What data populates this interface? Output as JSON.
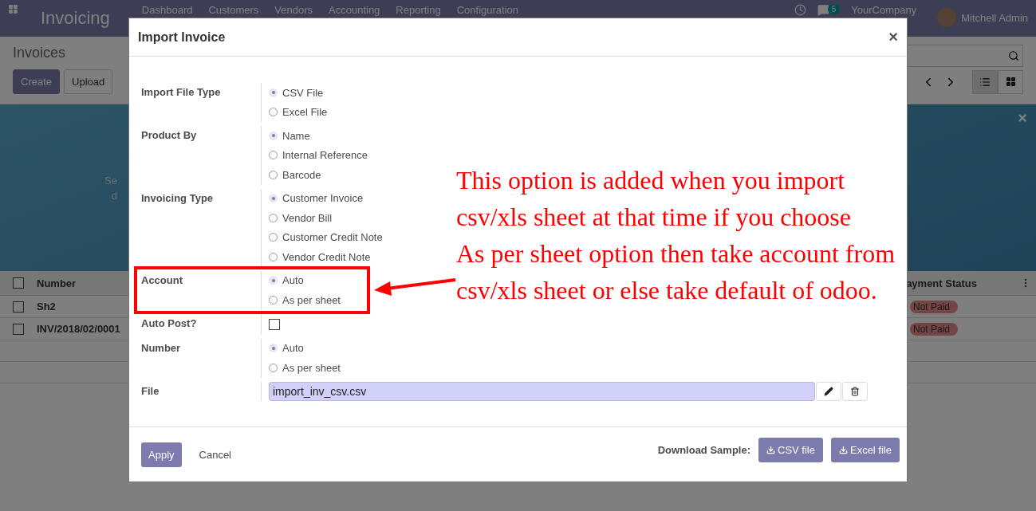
{
  "navbar": {
    "app_title": "Invoicing",
    "menu": [
      "Dashboard",
      "Customers",
      "Vendors",
      "Accounting",
      "Reporting",
      "Configuration"
    ],
    "chat_count": "5",
    "company": "YourCompany",
    "user": "Mitchell Admin"
  },
  "control_panel": {
    "title": "Invoices",
    "buttons": [
      "Create",
      "Upload"
    ]
  },
  "banner": {
    "text_fragments": [
      "Se",
      "d"
    ]
  },
  "list": {
    "columns": [
      "Number",
      "ayment Status"
    ],
    "all_checked": false,
    "rows": [
      {
        "number": "Sh2",
        "status": "Not Paid",
        "checked": false
      },
      {
        "number": "INV/2018/02/0001",
        "status": "Not Paid",
        "checked": false
      }
    ]
  },
  "dialog": {
    "title": "Import Invoice",
    "close": "×",
    "fields": [
      {
        "label": "Import File Type",
        "kind": "radio",
        "highlighted": false,
        "options": [
          {
            "label": "CSV File",
            "selected": true
          },
          {
            "label": "Excel File",
            "selected": false
          }
        ]
      },
      {
        "label": "Product By",
        "kind": "radio",
        "highlighted": false,
        "options": [
          {
            "label": "Name",
            "selected": true
          },
          {
            "label": "Internal Reference",
            "selected": false
          },
          {
            "label": "Barcode",
            "selected": false
          }
        ]
      },
      {
        "label": "Invoicing Type",
        "kind": "radio",
        "highlighted": false,
        "options": [
          {
            "label": "Customer Invoice",
            "selected": true
          },
          {
            "label": "Vendor Bill",
            "selected": false
          },
          {
            "label": "Customer Credit Note",
            "selected": false
          },
          {
            "label": "Vendor Credit Note",
            "selected": false
          }
        ]
      },
      {
        "label": "Account",
        "kind": "radio",
        "highlighted": true,
        "options": [
          {
            "label": "Auto",
            "selected": true
          },
          {
            "label": "As per sheet",
            "selected": false
          }
        ]
      },
      {
        "label": "Auto Post?",
        "kind": "checkbox",
        "highlighted": false,
        "checked": false
      },
      {
        "label": "Number",
        "kind": "radio",
        "highlighted": false,
        "options": [
          {
            "label": "Auto",
            "selected": true
          },
          {
            "label": "As per sheet",
            "selected": false
          }
        ]
      },
      {
        "label": "File",
        "kind": "file",
        "highlighted": false,
        "value": "import_inv_csv.csv"
      }
    ],
    "footer": {
      "apply": "Apply",
      "cancel": "Cancel",
      "download_label": "Download Sample:",
      "downloads": [
        "CSV file",
        "Excel file"
      ]
    }
  },
  "annotation": {
    "lines": [
      "This option is added when you import",
      "csv/xls sheet at that time if you choose",
      "As per sheet option then take account from",
      "csv/xls sheet or else take default of odoo."
    ]
  }
}
